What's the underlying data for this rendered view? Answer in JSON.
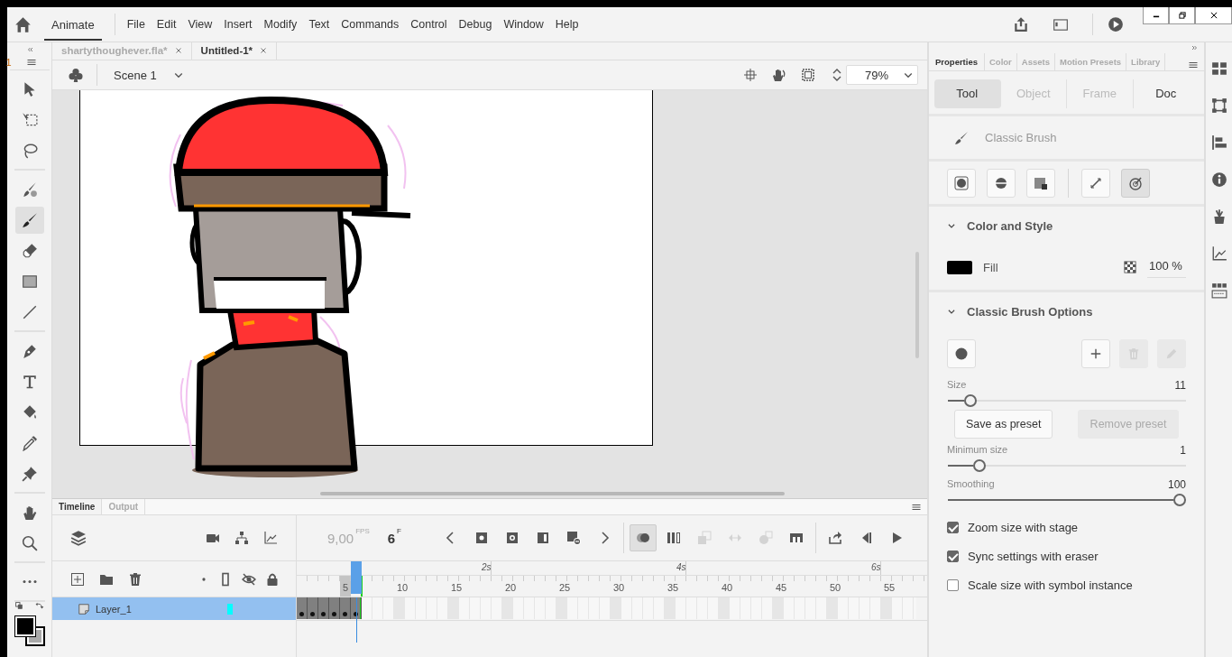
{
  "app": {
    "name": "Animate"
  },
  "menu": [
    "File",
    "Edit",
    "View",
    "Insert",
    "Modify",
    "Text",
    "Commands",
    "Control",
    "Debug",
    "Window",
    "Help"
  ],
  "tools_header": {
    "value": "1"
  },
  "tool_groups": [
    {
      "tools": [
        {
          "kind": "arrow",
          "selected": false
        },
        {
          "kind": "transform",
          "selected": false
        },
        {
          "kind": "lasso",
          "selected": false
        }
      ]
    },
    {
      "tools": [
        {
          "kind": "paintbrush",
          "selected": false
        },
        {
          "kind": "brush",
          "selected": true
        },
        {
          "kind": "eraser",
          "selected": false
        },
        {
          "kind": "rect",
          "selected": false
        },
        {
          "kind": "line",
          "selected": false
        }
      ]
    },
    {
      "tools": [
        {
          "kind": "pen",
          "selected": false
        },
        {
          "kind": "text",
          "selected": false
        },
        {
          "kind": "bucket",
          "selected": false
        },
        {
          "kind": "dropper",
          "selected": false
        },
        {
          "kind": "pin",
          "selected": false
        }
      ]
    },
    {
      "tools": [
        {
          "kind": "hand",
          "selected": false
        },
        {
          "kind": "zoom",
          "selected": false
        }
      ]
    },
    {
      "tools": [
        {
          "kind": "more",
          "selected": false
        }
      ]
    }
  ],
  "document_tabs": [
    {
      "label": "shartythoughever.fla*",
      "selected": false
    },
    {
      "label": "Untitled-1*",
      "selected": true
    }
  ],
  "scene": {
    "label": "Scene 1"
  },
  "zoom": {
    "value": "79%"
  },
  "panel_tabs": [
    {
      "label": "Properties",
      "selected": true
    },
    {
      "label": "Color",
      "selected": false
    },
    {
      "label": "Assets",
      "selected": false
    },
    {
      "label": "Motion Presets",
      "selected": false
    },
    {
      "label": "Library",
      "selected": false
    }
  ],
  "property_tabs": [
    {
      "label": "Tool",
      "selected": true,
      "disabled": false
    },
    {
      "label": "Object",
      "selected": false,
      "disabled": true
    },
    {
      "label": "Frame",
      "selected": false,
      "disabled": true
    },
    {
      "label": "Doc",
      "selected": false,
      "disabled": false
    }
  ],
  "tool_name": "Classic Brush",
  "brush_modes": [
    {
      "kind": "object",
      "selected": false
    },
    {
      "kind": "mode",
      "selected": false
    },
    {
      "kind": "lock",
      "selected": false
    },
    {
      "kind": "pressure",
      "selected": false
    },
    {
      "kind": "tilt",
      "selected": true
    }
  ],
  "color_and_style": {
    "title": "Color and Style",
    "expanded": true,
    "fill_label": "Fill",
    "opacity": "100 %"
  },
  "brush_options": {
    "title": "Classic Brush Options",
    "expanded": true,
    "size": {
      "label": "Size",
      "value": "11",
      "level": 0.07
    },
    "save_button": "Save as preset",
    "remove_button": {
      "label": "Remove preset",
      "disabled": true
    },
    "minimum_size": {
      "label": "Minimum size",
      "value": "1",
      "level": 0.11
    },
    "smoothing": {
      "label": "Smoothing",
      "value": "100",
      "level": 1
    },
    "checkboxes": [
      {
        "label": "Zoom size with stage",
        "checked": true
      },
      {
        "label": "Sync settings with eraser",
        "checked": true
      },
      {
        "label": "Scale size with symbol instance",
        "checked": false
      }
    ]
  },
  "timeline": {
    "tabs": [
      {
        "label": "Timeline",
        "selected": true
      },
      {
        "label": "Output",
        "selected": false
      }
    ],
    "fps": "9,00",
    "fps_unit": "FPS",
    "frame": "6",
    "frame_unit": "F",
    "controls": [
      {
        "kind": "prev",
        "disabled": false,
        "selected": false
      },
      {
        "kind": "keyframe",
        "disabled": false,
        "selected": false
      },
      {
        "kind": "blankkey",
        "disabled": false,
        "selected": false
      },
      {
        "kind": "frame",
        "disabled": false,
        "selected": false
      },
      {
        "kind": "delframe",
        "disabled": false,
        "selected": false
      },
      {
        "kind": "next",
        "disabled": false,
        "selected": false
      },
      {
        "kind": "onion",
        "disabled": false,
        "selected": true
      },
      {
        "kind": "multiframe",
        "disabled": false,
        "selected": false
      },
      {
        "kind": "paste",
        "disabled": true,
        "selected": false
      },
      {
        "kind": "swap",
        "disabled": true,
        "selected": false
      },
      {
        "kind": "paste2",
        "disabled": true,
        "selected": false
      },
      {
        "kind": "tween",
        "disabled": false,
        "selected": false
      },
      {
        "kind": "loop",
        "disabled": false,
        "selected": false
      },
      {
        "kind": "stepback",
        "disabled": false,
        "selected": false
      },
      {
        "kind": "play",
        "disabled": false,
        "selected": false
      }
    ],
    "time_labels": [
      "2s",
      "4s",
      "6s"
    ],
    "frame_numbers": [
      "5",
      "10",
      "15",
      "20",
      "25",
      "30",
      "35",
      "40",
      "45",
      "50",
      "55"
    ],
    "layers": [
      {
        "name": "Layer_1",
        "selected": true,
        "color": "#00ffff",
        "frames": [
          {
            "keyframe": true,
            "current": false
          },
          {
            "keyframe": true,
            "current": false
          },
          {
            "keyframe": true,
            "current": false
          },
          {
            "keyframe": true,
            "current": false
          },
          {
            "keyframe": true,
            "current": false
          },
          {
            "keyframe": true,
            "current": true
          }
        ]
      }
    ]
  }
}
